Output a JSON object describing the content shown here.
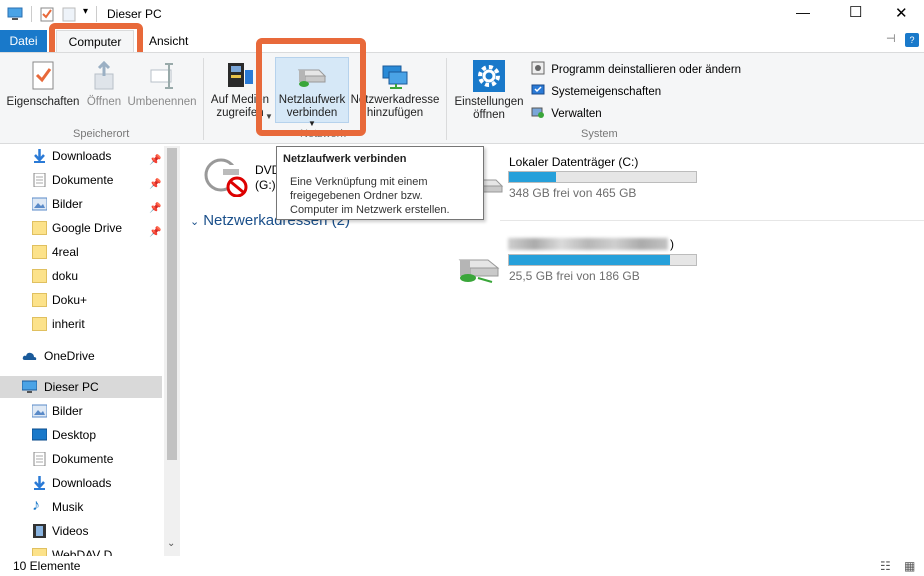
{
  "window": {
    "title": "Dieser PC",
    "min": "—",
    "max": "☐",
    "close": "✕"
  },
  "tabs": [
    {
      "label": "Datei"
    },
    {
      "label": "Computer"
    },
    {
      "label": "Ansicht"
    }
  ],
  "ribbon": {
    "speicherort": {
      "label": "Speicherort",
      "eigenschaften": "Eigenschaften",
      "oeffnen": "Öffnen",
      "umbenennen": "Umbenennen"
    },
    "netzwerk": {
      "label": "Netzwerk",
      "auf_medien_1": "Auf Medien",
      "auf_medien_2": "zugreifen",
      "netzlaufwerk_1": "Netzlaufwerk",
      "netzlaufwerk_2": "verbinden",
      "netzwerkadresse_1": "Netzwerkadresse",
      "netzwerkadresse_2": "hinzufügen"
    },
    "system": {
      "label": "System",
      "einstellungen_1": "Einstellungen",
      "einstellungen_2": "öffnen",
      "programm": "Programm deinstallieren oder ändern",
      "systemeigenschaften": "Systemeigenschaften",
      "verwalten": "Verwalten"
    }
  },
  "tooltip": {
    "title": "Netzlaufwerk verbinden",
    "line1": "Eine Verknüpfung mit einem",
    "line2": "freigegebenen Ordner bzw.",
    "line3": "Computer im Netzwerk erstellen."
  },
  "nav": {
    "items": [
      {
        "label": "Downloads"
      },
      {
        "label": "Dokumente"
      },
      {
        "label": "Bilder"
      },
      {
        "label": "Google Drive"
      },
      {
        "label": "4real"
      },
      {
        "label": "doku"
      },
      {
        "label": "Doku+"
      },
      {
        "label": "inherit"
      },
      {
        "label": "OneDrive"
      },
      {
        "label": "Dieser PC"
      },
      {
        "label": "Bilder"
      },
      {
        "label": "Desktop"
      },
      {
        "label": "Dokumente"
      },
      {
        "label": "Downloads"
      },
      {
        "label": "Musik"
      },
      {
        "label": "Videos"
      },
      {
        "label": "WebDAV D"
      }
    ]
  },
  "content": {
    "dvd_1": "DVD",
    "dvd_2": "(G:)",
    "local_name": "Lokaler Datenträger (C:)",
    "local_free": "348 GB frei von 465 GB",
    "local_used_fraction": 0.25,
    "section_network": "Netzwerkadressen (2)",
    "net_name_tail": ")",
    "net_free": "25,5 GB frei von 186 GB",
    "net_used_fraction": 0.86
  },
  "status": {
    "count": "10 Elemente"
  },
  "colors": {
    "accent": "#1979ca",
    "highlight": "#e8693a",
    "bar_fill": "#26a0da"
  }
}
